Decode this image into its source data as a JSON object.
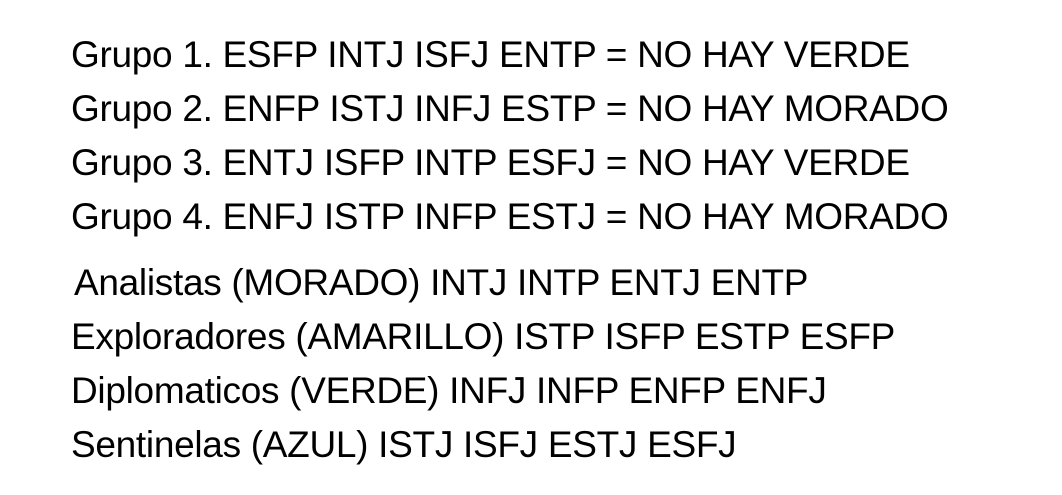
{
  "groups": [
    "Grupo 1. ESFP INTJ ISFJ ENTP = NO HAY VERDE",
    "Grupo 2. ENFP ISTJ INFJ ESTP = NO HAY MORADO",
    "Grupo 3. ENTJ ISFP INTP ESFJ = NO HAY VERDE",
    "Grupo 4. ENFJ ISTP INFP ESTJ = NO HAY MORADO"
  ],
  "categories": [
    "Analistas (MORADO) INTJ INTP ENTJ ENTP",
    "Exploradores (AMARILLO) ISTP ISFP ESTP ESFP",
    "Diplomaticos (VERDE) INFJ INFP ENFP ENFJ",
    "Sentinelas (AZUL) ISTJ ISFJ ESTJ ESFJ"
  ]
}
